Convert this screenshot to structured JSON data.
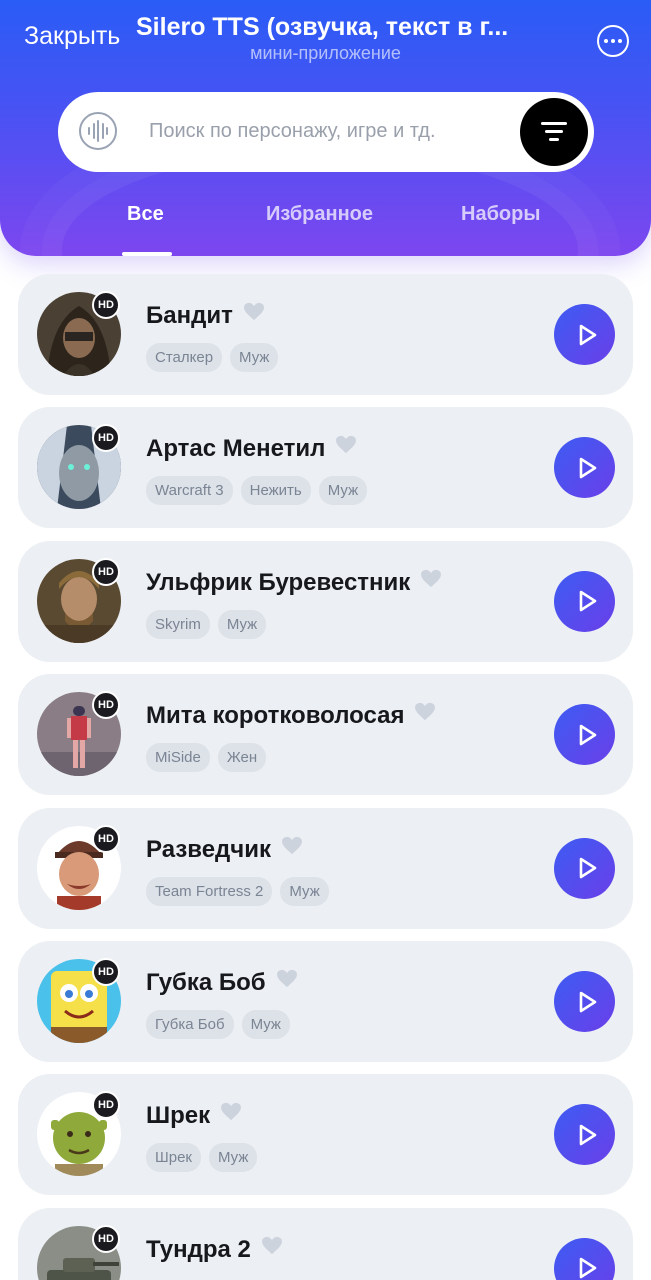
{
  "header": {
    "close_label": "Закрыть",
    "title": "Silero TTS (озвучка, текст в г...",
    "subtitle": "мини-приложение",
    "more_icon": "more-dots-icon",
    "accent_gradient": [
      "#2a5cf6",
      "#7d46ef"
    ]
  },
  "search": {
    "placeholder": "Поиск по персонажу, игре и тд.",
    "left_icon": "sound-wave-icon",
    "filter_icon": "filter-icon"
  },
  "tabs": [
    {
      "label": "Все",
      "active": true
    },
    {
      "label": "Избранное",
      "active": false
    },
    {
      "label": "Наборы",
      "active": false
    }
  ],
  "characters": [
    {
      "name": "Бандит",
      "badge": "HD",
      "tags": [
        "Сталкер",
        "Муж"
      ],
      "avatar": "hooded-stalker"
    },
    {
      "name": "Артас Менетил",
      "badge": "HD",
      "tags": [
        "Warcraft 3",
        "Нежить",
        "Муж"
      ],
      "avatar": "lich-king"
    },
    {
      "name": "Ульфрик Буревестник",
      "badge": "HD",
      "tags": [
        "Skyrim",
        "Муж"
      ],
      "avatar": "nord-warrior"
    },
    {
      "name": "Мита коротковолосая",
      "badge": "HD",
      "tags": [
        "MiSide",
        "Жен"
      ],
      "avatar": "anime-girl"
    },
    {
      "name": "Разведчик",
      "badge": "HD",
      "tags": [
        "Team Fortress 2",
        "Муж"
      ],
      "avatar": "tf2-scout"
    },
    {
      "name": "Губка Боб",
      "badge": "HD",
      "tags": [
        "Губка Боб",
        "Муж"
      ],
      "avatar": "spongebob"
    },
    {
      "name": "Шрек",
      "badge": "HD",
      "tags": [
        "Шрек",
        "Муж"
      ],
      "avatar": "shrek"
    },
    {
      "name": "Тундра 2",
      "badge": "HD",
      "tags": [],
      "avatar": "tank"
    }
  ]
}
